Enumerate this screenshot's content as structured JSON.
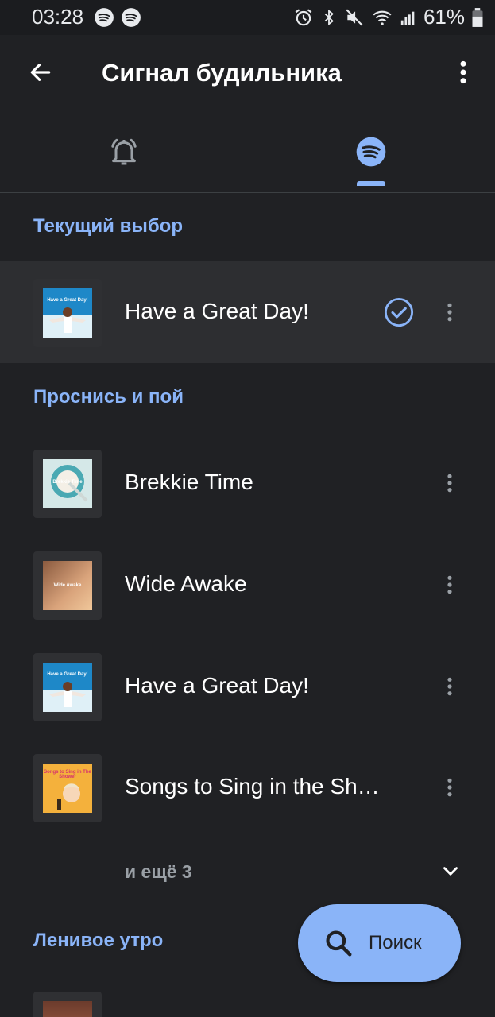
{
  "status_bar": {
    "time": "03:28",
    "battery_percent": "61%",
    "left_icons": [
      "spotify-icon",
      "spotify-icon"
    ],
    "right_icons": [
      "alarm-icon",
      "bluetooth-icon",
      "mute-icon",
      "wifi-icon",
      "signal-icon",
      "battery-icon"
    ]
  },
  "app_bar": {
    "title": "Сигнал будильника",
    "back_icon": "arrow-back-icon",
    "menu_icon": "more-vert-icon"
  },
  "tabs": [
    {
      "icon": "bell-icon",
      "selected": false
    },
    {
      "icon": "spotify-icon",
      "selected": true
    }
  ],
  "current_section": {
    "header": "Текущий выбор",
    "item": {
      "title": "Have a Great Day!",
      "art_text": "Have a Great Day!",
      "selected": true
    }
  },
  "wake_section": {
    "header": "Проснись и пой",
    "items": [
      {
        "title": "Brekkie Time",
        "art_text": "Brekkie Time"
      },
      {
        "title": "Wide Awake",
        "art_text": "Wide Awake"
      },
      {
        "title": "Have a Great Day!",
        "art_text": "Have a Great Day!"
      },
      {
        "title": "Songs to Sing in the Shower",
        "art_text": "Songs to Sing in The Shower"
      }
    ],
    "more_label": "и ещё 3"
  },
  "lazy_section": {
    "header": "Ленивое утро"
  },
  "fab": {
    "label": "Поиск",
    "icon": "search-icon"
  },
  "colors": {
    "background": "#202124",
    "accent": "#8ab4f8",
    "selected_row": "#2d2e31",
    "spotify_tab": "#8ab4f8"
  }
}
